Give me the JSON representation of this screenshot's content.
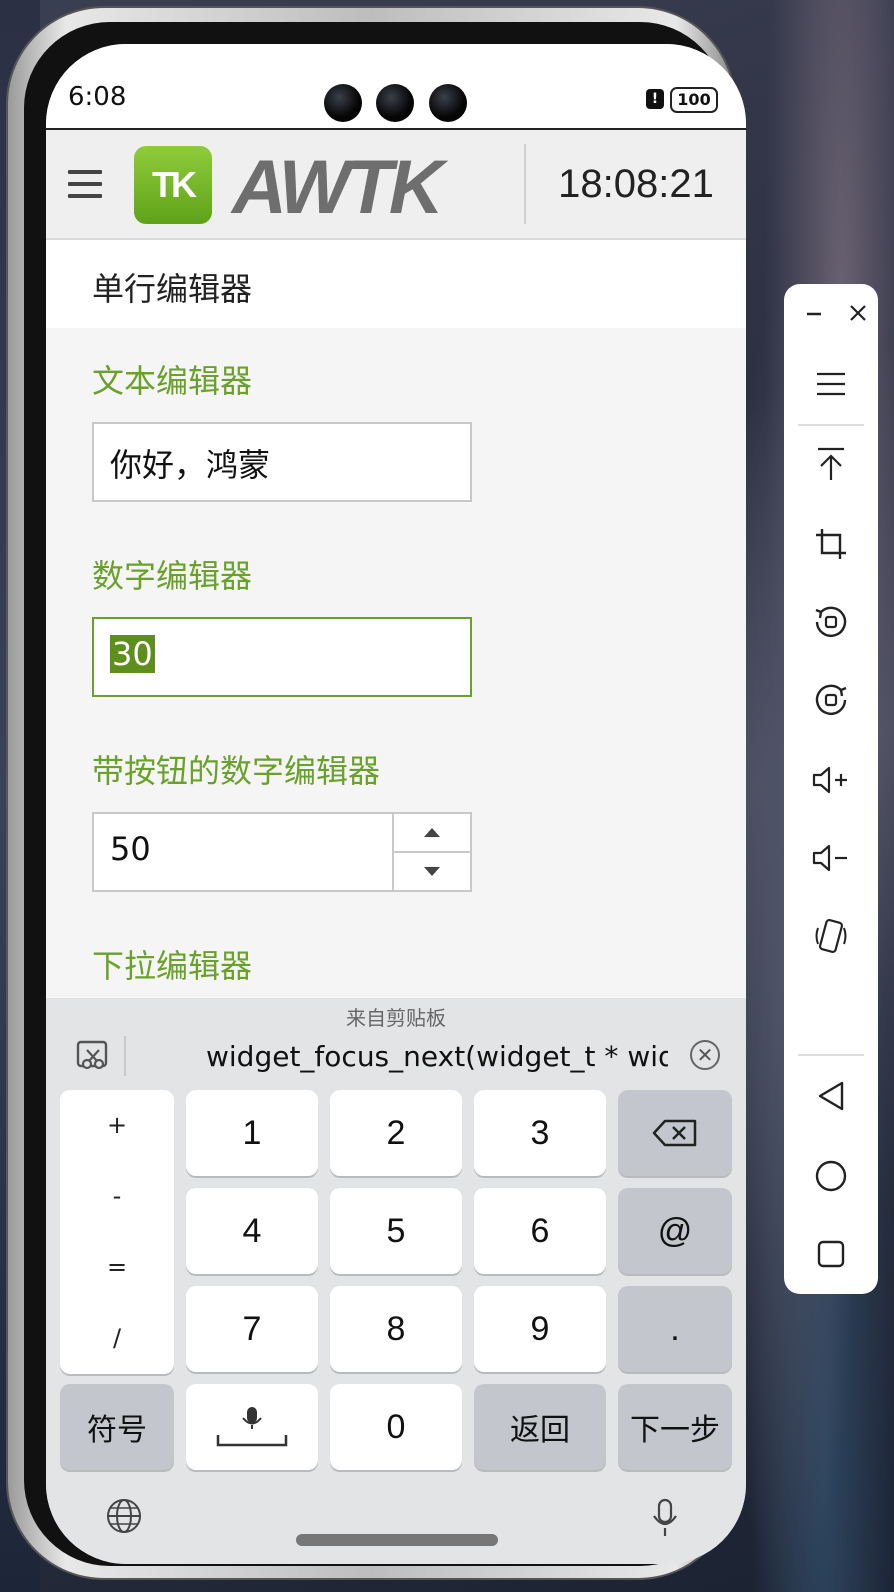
{
  "status": {
    "time": "6:08",
    "battery": "100",
    "alert": "!"
  },
  "header": {
    "logo_tk": "TK",
    "logo_text": "AWTK",
    "clock": "18:08:21"
  },
  "page": {
    "title": "单行编辑器"
  },
  "sections": {
    "text": {
      "label": "文本编辑器",
      "value": "你好，鸿蒙"
    },
    "number": {
      "label": "数字编辑器",
      "value": "30"
    },
    "spin": {
      "label": "带按钮的数字编辑器",
      "value": "50"
    },
    "dropdown": {
      "label": "下拉编辑器"
    }
  },
  "clipboard": {
    "title": "来自剪贴板",
    "text": "widget_focus_next(widget_t * widget)"
  },
  "keyboard": {
    "symbols": [
      "+",
      "-",
      "=",
      "/"
    ],
    "digits": [
      "1",
      "2",
      "3",
      "4",
      "5",
      "6",
      "7",
      "8",
      "9",
      "0"
    ],
    "at": "@",
    "dot": ".",
    "sym_key": "符号",
    "return_key": "返回",
    "next_key": "下一步"
  },
  "colors": {
    "accent": "#6aa12a",
    "logo_green": "#7cbb2c"
  }
}
